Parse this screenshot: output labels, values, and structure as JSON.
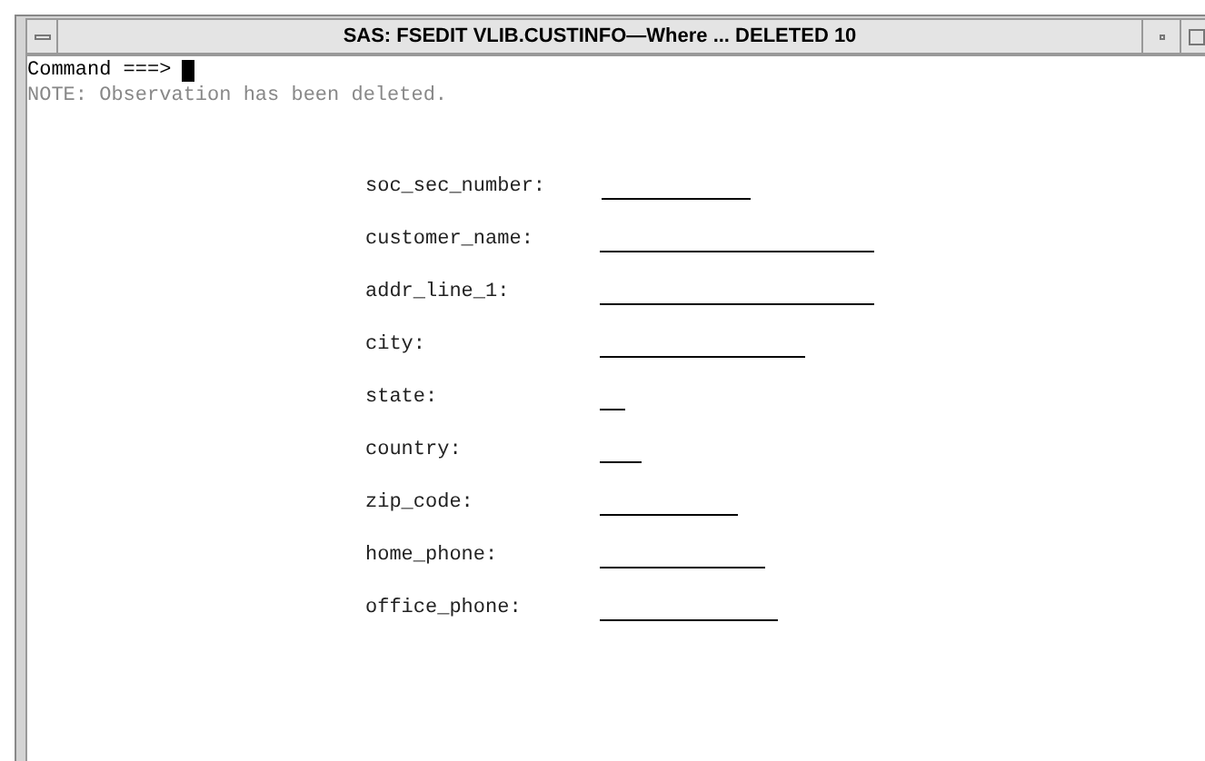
{
  "window": {
    "title": "SAS: FSEDIT VLIB.CUSTINFO—Where ... DELETED 10"
  },
  "command": {
    "label": "Command ===>"
  },
  "message": "NOTE: Observation has been deleted.",
  "fields": [
    {
      "label": "soc_sec_number:"
    },
    {
      "label": "customer_name:"
    },
    {
      "label": "addr_line_1:"
    },
    {
      "label": "city:"
    },
    {
      "label": "state:"
    },
    {
      "label": "country:"
    },
    {
      "label": "zip_code:"
    },
    {
      "label": "home_phone:"
    },
    {
      "label": "office_phone:"
    }
  ]
}
